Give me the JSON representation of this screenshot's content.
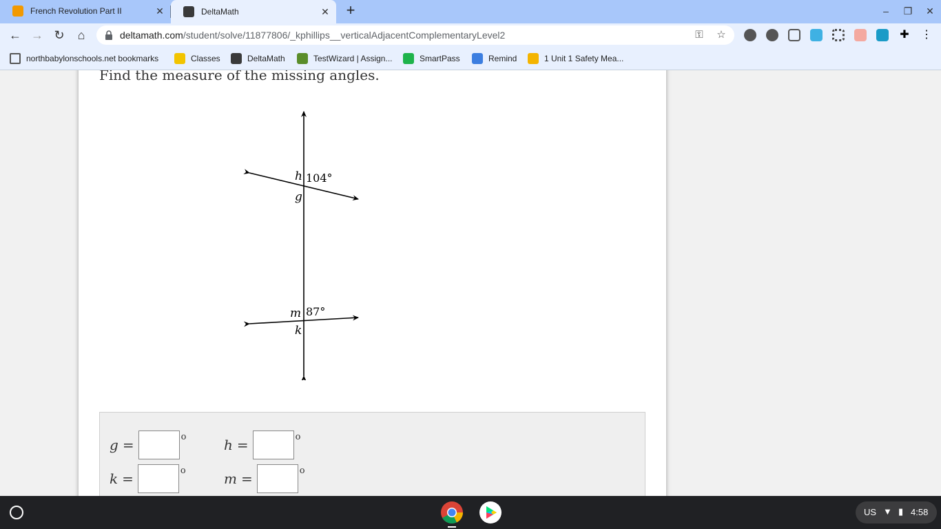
{
  "browser": {
    "tabs": [
      {
        "title": "French Revolution Part II",
        "active": false
      },
      {
        "title": "DeltaMath",
        "active": true
      }
    ],
    "url_host": "deltamath.com",
    "url_path": "/student/solve/11877806/_kphillips__verticalAdjacentComplementaryLevel2",
    "bookmarks": [
      {
        "label": "northbabylonschools.net bookmarks",
        "icon": "folder-icon"
      },
      {
        "label": "Classes",
        "icon": "classroom-icon"
      },
      {
        "label": "DeltaMath",
        "icon": "deltamath-icon"
      },
      {
        "label": "TestWizard | Assign...",
        "icon": "testwizard-icon"
      },
      {
        "label": "SmartPass",
        "icon": "smartpass-icon"
      },
      {
        "label": "Remind",
        "icon": "remind-icon"
      },
      {
        "label": "1 Unit 1 Safety Mea...",
        "icon": "slides-icon"
      }
    ]
  },
  "problem": {
    "prompt": "Find the measure of the missing angles.",
    "diagram": {
      "top_known_angle": "104°",
      "bottom_known_angle": "87°",
      "labels": {
        "h": "h",
        "g": "g",
        "m": "m",
        "k": "k"
      }
    },
    "answers": [
      {
        "var": "g",
        "eq": "=",
        "value": "",
        "deg": "o"
      },
      {
        "var": "h",
        "eq": "=",
        "value": "",
        "deg": "o"
      },
      {
        "var": "k",
        "eq": "=",
        "value": "",
        "deg": "o"
      },
      {
        "var": "m",
        "eq": "=",
        "value": "",
        "deg": "o"
      }
    ]
  },
  "taskbar": {
    "locale": "US",
    "time": "4:58"
  },
  "colors": {
    "tabstrip": "#a8c7fa",
    "toolbar": "#e8f0fe",
    "taskbar": "#202124"
  }
}
